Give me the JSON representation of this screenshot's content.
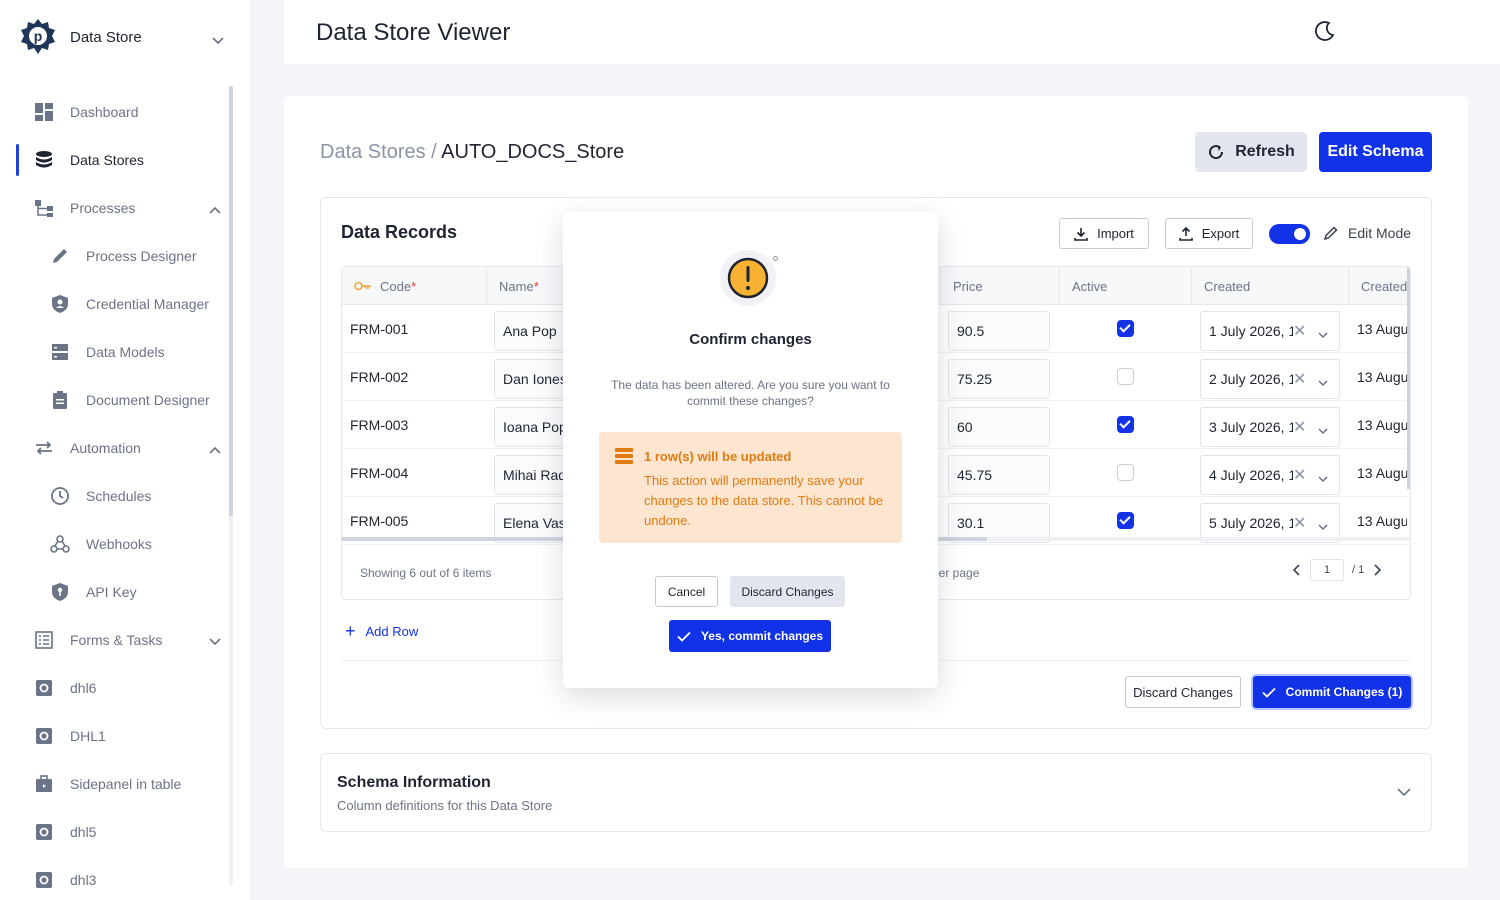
{
  "app": {
    "name": "Data Store",
    "page_title": "Data Store Viewer"
  },
  "sidebar": {
    "items": [
      {
        "label": "Dashboard",
        "icon": "dashboard-icon"
      },
      {
        "label": "Data Stores",
        "icon": "database-icon",
        "active": true
      },
      {
        "label": "Processes",
        "icon": "process-icon",
        "expanded": true
      },
      {
        "label": "Process Designer",
        "icon": "pencil-icon"
      },
      {
        "label": "Credential Manager",
        "icon": "shield-user-icon"
      },
      {
        "label": "Data Models",
        "icon": "server-icon"
      },
      {
        "label": "Document Designer",
        "icon": "clipboard-icon"
      },
      {
        "label": "Automation",
        "icon": "repeat-icon",
        "expanded": true
      },
      {
        "label": "Schedules",
        "icon": "clock-icon"
      },
      {
        "label": "Webhooks",
        "icon": "webhook-icon"
      },
      {
        "label": "API Key",
        "icon": "shield-key-icon"
      },
      {
        "label": "Forms & Tasks",
        "icon": "list-icon",
        "expanded": false
      },
      {
        "label": "dhl6",
        "icon": "gear-box-icon"
      },
      {
        "label": "DHL1",
        "icon": "gear-box-icon"
      },
      {
        "label": "Sidepanel in table",
        "icon": "briefcase-icon"
      },
      {
        "label": "dhl5",
        "icon": "gear-box-icon"
      },
      {
        "label": "dhl3",
        "icon": "gear-box-icon"
      }
    ]
  },
  "breadcrumb": {
    "parent": "Data Stores /",
    "current": "AUTO_DOCS_Store"
  },
  "actions": {
    "refresh": "Refresh",
    "edit_schema": "Edit Schema"
  },
  "records": {
    "title": "Data Records",
    "import": "Import",
    "export": "Export",
    "edit_mode": "Edit Mode",
    "edit_mode_on": true,
    "columns": [
      "Code",
      "Name",
      "Price",
      "Active",
      "Created",
      "Created"
    ],
    "rows": [
      {
        "code": "FRM-001",
        "name": "Ana Pop",
        "price": "90.5",
        "active": true,
        "created": "1 July 2026, 1",
        "created2": "13 Augu"
      },
      {
        "code": "FRM-002",
        "name": "Dan Ionescu",
        "price": "75.25",
        "active": false,
        "created": "2 July 2026, 1",
        "created2": "13 Augu"
      },
      {
        "code": "FRM-003",
        "name": "Ioana Pop",
        "price": "60",
        "active": true,
        "created": "3 July 2026, 1",
        "created2": "13 Augu"
      },
      {
        "code": "FRM-004",
        "name": "Mihai Radu",
        "price": "45.75",
        "active": false,
        "created": "4 July 2026, 1",
        "created2": "13 Augu"
      },
      {
        "code": "FRM-005",
        "name": "Elena Vasile",
        "price": "30.1",
        "active": true,
        "created": "5 July 2026, 1",
        "created2": "13 Augu"
      }
    ],
    "showing": "Showing 6 out of 6 items",
    "per_page": "per page",
    "page": "1",
    "page_total": "/ 1",
    "add_row": "Add Row",
    "discard": "Discard Changes",
    "commit": "Commit Changes (1)"
  },
  "schema": {
    "title": "Schema Information",
    "subtitle": "Column definitions for this Data Store"
  },
  "modal": {
    "title": "Confirm changes",
    "description": "The data has been altered. Are you sure you want to commit these changes?",
    "warning_title": "1 row(s) will be updated",
    "warning_body": "This action will permanently save your changes to the data store. This cannot be undone.",
    "cancel": "Cancel",
    "discard": "Discard Changes",
    "confirm": "Yes, commit changes"
  },
  "colors": {
    "primary": "#1132e6",
    "warning_bg": "#fde5cf",
    "warning_text": "#e07b12",
    "required": "#e53935"
  }
}
